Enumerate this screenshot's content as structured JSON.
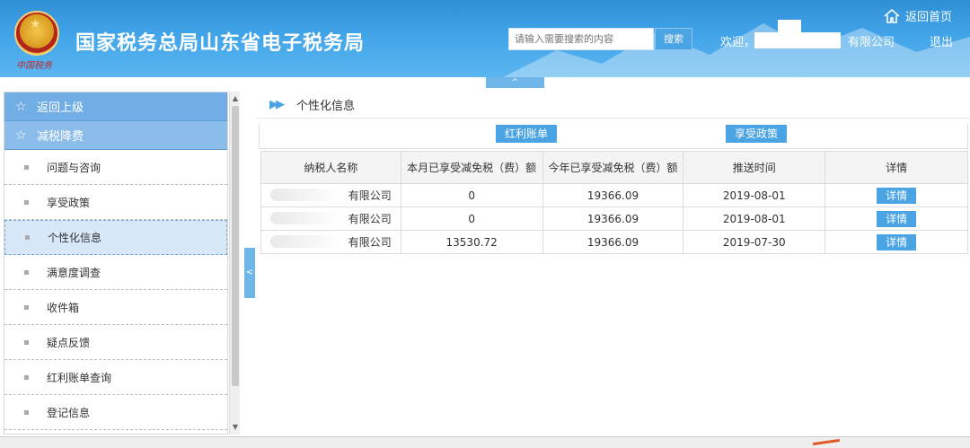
{
  "header": {
    "site_title": "国家税务总局山东省电子税务局",
    "emblem_script": "中国税务",
    "search_placeholder": "请输入需要搜索的内容",
    "search_button": "搜索",
    "welcome": "欢迎，",
    "company_suffix": "有限公司",
    "logout": "退出",
    "home": "返回首页",
    "top_toggle": "^"
  },
  "sidebar": {
    "back": "返回上级",
    "section": "减税降费",
    "items": [
      {
        "label": "问题与咨询"
      },
      {
        "label": "享受政策"
      },
      {
        "label": "个性化信息"
      },
      {
        "label": "满意度调查"
      },
      {
        "label": "收件箱"
      },
      {
        "label": "疑点反馈"
      },
      {
        "label": "红利账单查询"
      },
      {
        "label": "登记信息"
      }
    ],
    "active_index": 2,
    "toggle": "<"
  },
  "main": {
    "crumb": "个性化信息",
    "tabs": [
      {
        "label": "红利账单"
      },
      {
        "label": "享受政策"
      }
    ],
    "table": {
      "headers": [
        "纳税人名称",
        "本月已享受减免税（费）额",
        "今年已享受减免税（费）额",
        "推送时间",
        "详情"
      ],
      "rows": [
        {
          "name": "有限公司",
          "month": "0",
          "year": "19366.09",
          "time": "2019-08-01",
          "action": "详情"
        },
        {
          "name": "有限公司",
          "month": "0",
          "year": "19366.09",
          "time": "2019-08-01",
          "action": "详情"
        },
        {
          "name": "有限公司",
          "month": "13530.72",
          "year": "19366.09",
          "time": "2019-07-30",
          "action": "详情"
        }
      ]
    }
  },
  "colors": {
    "header_blue": "#3f9fe2",
    "accent": "#4aa3e3",
    "sidebar_head": "#71aee6",
    "active_item": "#d7e8f8"
  }
}
